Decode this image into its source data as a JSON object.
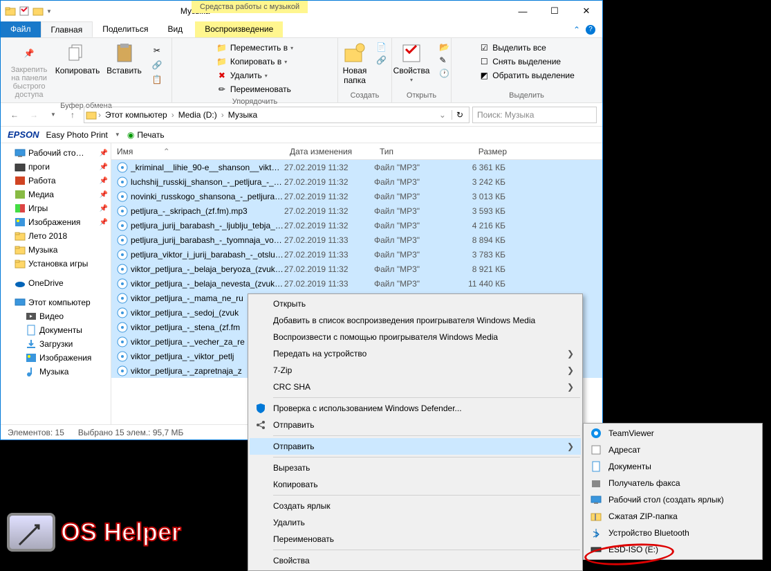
{
  "title": "Музыка",
  "ctx_tab": "Средства работы с музыкой",
  "tabs": {
    "file": "Файл",
    "home": "Главная",
    "share": "Поделиться",
    "view": "Вид",
    "play": "Воспроизведение"
  },
  "ribbon": {
    "clipboard": {
      "label": "Буфер обмена",
      "pin": "Закрепить на панели быстрого доступа",
      "copy": "Копировать",
      "paste": "Вставить"
    },
    "organize": {
      "label": "Упорядочить",
      "move": "Переместить в",
      "copyto": "Копировать в",
      "delete": "Удалить",
      "rename": "Переименовать"
    },
    "new": {
      "label": "Создать",
      "newfolder": "Новая папка"
    },
    "open": {
      "label": "Открыть",
      "props": "Свойства"
    },
    "select": {
      "label": "Выделить",
      "all": "Выделить все",
      "none": "Снять выделение",
      "invert": "Обратить выделение"
    }
  },
  "breadcrumb": [
    "Этот компьютер",
    "Media (D:)",
    "Музыка"
  ],
  "search_placeholder": "Поиск: Музыка",
  "epson": {
    "brand": "EPSON",
    "app": "Easy Photo Print",
    "print": "Печать"
  },
  "tree": [
    {
      "label": "Рабочий сто…",
      "icon": "desktop",
      "pin": true
    },
    {
      "label": "проги",
      "icon": "folder-dark",
      "pin": true
    },
    {
      "label": "Работа",
      "icon": "onenote",
      "pin": true
    },
    {
      "label": "Медиа",
      "icon": "media",
      "pin": true
    },
    {
      "label": "Игры",
      "icon": "games",
      "pin": true
    },
    {
      "label": "Изображения",
      "icon": "pictures",
      "pin": true
    },
    {
      "label": "Лето 2018",
      "icon": "folder"
    },
    {
      "label": "Музыка",
      "icon": "folder"
    },
    {
      "label": "Установка игры",
      "icon": "folder"
    },
    {
      "label": "OneDrive",
      "icon": "onedrive",
      "sep": true
    },
    {
      "label": "Этот компьютер",
      "icon": "pc",
      "sep": true
    },
    {
      "label": "Видео",
      "icon": "video",
      "l2": true
    },
    {
      "label": "Документы",
      "icon": "docs",
      "l2": true
    },
    {
      "label": "Загрузки",
      "icon": "downloads",
      "l2": true
    },
    {
      "label": "Изображения",
      "icon": "pictures",
      "l2": true
    },
    {
      "label": "Музыка",
      "icon": "music",
      "l2": true
    }
  ],
  "columns": {
    "name": "Имя",
    "date": "Дата изменения",
    "type": "Тип",
    "size": "Размер"
  },
  "files": [
    {
      "n": "_kriminal__lihie_90-e__shanson__viktor_p…",
      "d": "27.02.2019 11:32",
      "t": "Файл \"MP3\"",
      "s": "6 361 КБ",
      "sel": true
    },
    {
      "n": "luchshij_russkij_shanson_-_petljura_-_pla…",
      "d": "27.02.2019 11:32",
      "t": "Файл \"MP3\"",
      "s": "3 242 КБ",
      "sel": true
    },
    {
      "n": "novinki_russkogo_shansona_-_petljura_ju…",
      "d": "27.02.2019 11:32",
      "t": "Файл \"MP3\"",
      "s": "3 013 КБ",
      "sel": true
    },
    {
      "n": "petljura_-_skripach_(zf.fm).mp3",
      "d": "27.02.2019 11:32",
      "t": "Файл \"MP3\"",
      "s": "3 593 КБ",
      "sel": true
    },
    {
      "n": "petljura_jurij_barabash_-_ljublju_tebja_(zv…",
      "d": "27.02.2019 11:32",
      "t": "Файл \"MP3\"",
      "s": "4 216 КБ",
      "sel": true
    },
    {
      "n": "petljura_jurij_barabash_-_tyomnaja_voda…",
      "d": "27.02.2019 11:33",
      "t": "Файл \"MP3\"",
      "s": "8 894 КБ",
      "sel": true
    },
    {
      "n": "petljura_viktor_i_jurij_barabash_-_otsluzhi…",
      "d": "27.02.2019 11:33",
      "t": "Файл \"MP3\"",
      "s": "3 783 КБ",
      "sel": true
    },
    {
      "n": "viktor_petljura_-_belaja_beryoza_(zvukoff.…",
      "d": "27.02.2019 11:32",
      "t": "Файл \"MP3\"",
      "s": "8 921 КБ",
      "sel": true
    },
    {
      "n": "viktor_petljura_-_belaja_nevesta_(zvukoff.…",
      "d": "27.02.2019 11:33",
      "t": "Файл \"MP3\"",
      "s": "11 440 КБ",
      "sel": true
    },
    {
      "n": "viktor_petljura_-_mama_ne_ru",
      "d": "",
      "t": "",
      "s": "",
      "sel": true
    },
    {
      "n": "viktor_petljura_-_sedoj_(zvuk",
      "d": "",
      "t": "",
      "s": "",
      "sel": true
    },
    {
      "n": "viktor_petljura_-_stena_(zf.fm",
      "d": "",
      "t": "",
      "s": "",
      "sel": true
    },
    {
      "n": "viktor_petljura_-_vecher_za_re",
      "d": "",
      "t": "",
      "s": "",
      "sel": true
    },
    {
      "n": "viktor_petljura_-_viktor_petlj",
      "d": "",
      "t": "",
      "s": "",
      "sel": true
    },
    {
      "n": "viktor_petljura_-_zapretnaja_z",
      "d": "",
      "t": "",
      "s": "",
      "sel": true
    }
  ],
  "status": {
    "count": "Элементов: 15",
    "sel": "Выбрано 15 элем.: 95,7 МБ"
  },
  "ctx": [
    {
      "t": "Открыть"
    },
    {
      "t": "Добавить в список воспроизведения проигрывателя Windows Media"
    },
    {
      "t": "Воспроизвести с помощью проигрывателя Windows Media"
    },
    {
      "t": "Передать на устройство",
      "sub": true
    },
    {
      "t": "7-Zip",
      "sub": true
    },
    {
      "t": "CRC SHA",
      "sub": true
    },
    {
      "t": "Проверка с использованием Windows Defender...",
      "icon": "shield",
      "sep_before": true
    },
    {
      "t": "Отправить",
      "icon": "share"
    },
    {
      "t": "Отправить",
      "sub": true,
      "hov": true,
      "sep_before": true
    },
    {
      "t": "Вырезать",
      "sep_before": true
    },
    {
      "t": "Копировать"
    },
    {
      "t": "Создать ярлык",
      "sep_before": true
    },
    {
      "t": "Удалить"
    },
    {
      "t": "Переименовать"
    },
    {
      "t": "Свойства",
      "sep_before": true
    }
  ],
  "sendto": [
    {
      "t": "TeamViewer",
      "icon": "tv"
    },
    {
      "t": "Адресат",
      "icon": "contact"
    },
    {
      "t": "Документы",
      "icon": "docs"
    },
    {
      "t": "Получатель факса",
      "icon": "fax"
    },
    {
      "t": "Рабочий стол (создать ярлык)",
      "icon": "desktop"
    },
    {
      "t": "Сжатая ZIP-папка",
      "icon": "zip"
    },
    {
      "t": "Устройство Bluetooth",
      "icon": "bt"
    },
    {
      "t": "ESD-ISO (E:)",
      "icon": "drive"
    }
  ]
}
